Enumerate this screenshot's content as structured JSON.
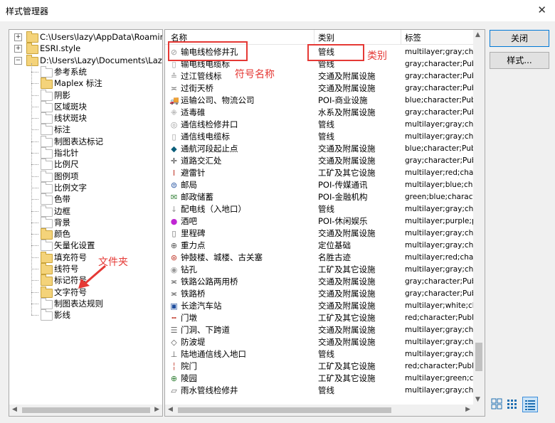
{
  "window": {
    "title": "样式管理器"
  },
  "tree": {
    "roots": [
      {
        "label": "C:\\Users\\lazy\\AppData\\Roaming\\E",
        "expanded": false
      },
      {
        "label": "ESRI.style",
        "expanded": false
      },
      {
        "label": "D:\\Users\\Lazy\\Documents\\Lazysh",
        "expanded": true
      }
    ],
    "children": [
      {
        "label": "参考系统",
        "filled": false
      },
      {
        "label": "Maplex 标注",
        "filled": true
      },
      {
        "label": "阴影",
        "filled": false
      },
      {
        "label": "区域斑块",
        "filled": false
      },
      {
        "label": "线状斑块",
        "filled": false
      },
      {
        "label": "标注",
        "filled": false
      },
      {
        "label": "制图表达标记",
        "filled": false
      },
      {
        "label": "指北针",
        "filled": false
      },
      {
        "label": "比例尺",
        "filled": false
      },
      {
        "label": "图例项",
        "filled": false
      },
      {
        "label": "比例文字",
        "filled": false
      },
      {
        "label": "色带",
        "filled": false
      },
      {
        "label": "边框",
        "filled": false
      },
      {
        "label": "背景",
        "filled": false
      },
      {
        "label": "颜色",
        "filled": true
      },
      {
        "label": "矢量化设置",
        "filled": false
      },
      {
        "label": "填充符号",
        "filled": true
      },
      {
        "label": "线符号",
        "filled": true
      },
      {
        "label": "标记符号",
        "filled": true
      },
      {
        "label": "文字符号",
        "filled": true
      },
      {
        "label": "制图表达规则",
        "filled": false
      },
      {
        "label": "影线",
        "filled": false
      }
    ]
  },
  "list": {
    "headers": {
      "name": "名称",
      "category": "类别",
      "tags": "标签"
    },
    "rows": [
      {
        "icon": "manhole-icon",
        "glyph": "⊘",
        "color": "#999999",
        "name": "输电线检修井孔",
        "category": "管线",
        "tags": "multilayer;gray;chara"
      },
      {
        "icon": "cable-marker-icon",
        "glyph": "▯",
        "color": "#999999",
        "name": "输电线电缆标",
        "category": "管线",
        "tags": "gray;character;Publ"
      },
      {
        "icon": "pipe-crossing-icon",
        "glyph": "≙",
        "color": "#999999",
        "name": "过江管线标",
        "category": "交通及附属设施",
        "tags": "gray;character;Publ"
      },
      {
        "icon": "overpass-icon",
        "glyph": "≍",
        "color": "#666666",
        "name": "过街天桥",
        "category": "交通及附属设施",
        "tags": "gray;character;Publ"
      },
      {
        "icon": "truck-icon",
        "glyph": "🚚",
        "color": "#1f4e9e",
        "name": "运输公司、物流公司",
        "category": "POI-商业设施",
        "tags": "blue;character;Publ"
      },
      {
        "icon": "dam-icon",
        "glyph": "⁜",
        "color": "#999999",
        "name": "适毒碓",
        "category": "水系及附属设施",
        "tags": "gray;character;Publ"
      },
      {
        "icon": "comm-manhole-icon",
        "glyph": "◎",
        "color": "#999999",
        "name": "通信线检修井口",
        "category": "管线",
        "tags": "multilayer;gray;chara"
      },
      {
        "icon": "comm-cable-icon",
        "glyph": "▯",
        "color": "#999999",
        "name": "通信线电缆标",
        "category": "管线",
        "tags": "multilayer;gray;chara"
      },
      {
        "icon": "diamond-icon",
        "glyph": "◆",
        "color": "#0b5e7a",
        "name": "通航河段起止点",
        "category": "交通及附属设施",
        "tags": "blue;character;Publ"
      },
      {
        "icon": "crossing-icon",
        "glyph": "✛",
        "color": "#333333",
        "name": "道路交汇处",
        "category": "交通及附属设施",
        "tags": "gray;character;Publ"
      },
      {
        "icon": "lightning-rod-icon",
        "glyph": "Ⅰ",
        "color": "#c0392b",
        "name": "避雷针",
        "category": "工矿及其它设施",
        "tags": "multilayer;red;chara"
      },
      {
        "icon": "post-office-icon",
        "glyph": "⊜",
        "color": "#1f4e9e",
        "name": "邮局",
        "category": "POI-传媒通讯",
        "tags": "multilayer;blue;chara"
      },
      {
        "icon": "postal-savings-icon",
        "glyph": "✉",
        "color": "#2e7d32",
        "name": "邮政储蓄",
        "category": "POI-金融机构",
        "tags": "green;blue;characte"
      },
      {
        "icon": "power-entry-icon",
        "glyph": "↓",
        "color": "#999999",
        "name": "配电线（入地口）",
        "category": "管线",
        "tags": "multilayer;gray;chara"
      },
      {
        "icon": "bar-icon",
        "glyph": "●",
        "color": "#c026d3",
        "name": "酒吧",
        "category": "POI-休闲娱乐",
        "tags": "multilayer;purple;pin"
      },
      {
        "icon": "milestone-icon",
        "glyph": "▯",
        "color": "#666666",
        "name": "里程碑",
        "category": "交通及附属设施",
        "tags": "multilayer;gray;chara"
      },
      {
        "icon": "gravity-point-icon",
        "glyph": "⊕",
        "color": "#555555",
        "name": "重力点",
        "category": "定位基础",
        "tags": "multilayer;gray;chara"
      },
      {
        "icon": "tower-icon",
        "glyph": "⊛",
        "color": "#c0392b",
        "name": "钟鼓楼、城楼、古关塞",
        "category": "名胜古迹",
        "tags": "multilayer;red;chara"
      },
      {
        "icon": "drill-hole-icon",
        "glyph": "◉",
        "color": "#999999",
        "name": "钻孔",
        "category": "工矿及其它设施",
        "tags": "multilayer;gray;chara"
      },
      {
        "icon": "rail-road-bridge-icon",
        "glyph": "≍",
        "color": "#333333",
        "name": "铁路公路两用桥",
        "category": "交通及附属设施",
        "tags": "gray;character;Publ"
      },
      {
        "icon": "railway-bridge-icon",
        "glyph": "≍",
        "color": "#333333",
        "name": "铁路桥",
        "category": "交通及附属设施",
        "tags": "gray;character;Publ"
      },
      {
        "icon": "bus-station-icon",
        "glyph": "▣",
        "color": "#1f4e9e",
        "name": "长途汽车站",
        "category": "交通及附属设施",
        "tags": "multilayer;white;cha"
      },
      {
        "icon": "gate-pier-icon",
        "glyph": "╍",
        "color": "#c0392b",
        "name": "门墩",
        "category": "工矿及其它设施",
        "tags": "red;character;Public"
      },
      {
        "icon": "gateway-icon",
        "glyph": "☰",
        "color": "#666666",
        "name": "门洞、下跨道",
        "category": "交通及附属设施",
        "tags": "multilayer;gray;chara"
      },
      {
        "icon": "breakwater-icon",
        "glyph": "◇",
        "color": "#555555",
        "name": "防波堤",
        "category": "交通及附属设施",
        "tags": "multilayer;gray;chara"
      },
      {
        "icon": "land-comm-entry-icon",
        "glyph": "⊥",
        "color": "#555555",
        "name": "陆地通信线入地口",
        "category": "管线",
        "tags": "multilayer;gray;chara"
      },
      {
        "icon": "courtyard-icon",
        "glyph": "╎",
        "color": "#c0392b",
        "name": "院门",
        "category": "工矿及其它设施",
        "tags": "red;character;Public"
      },
      {
        "icon": "cemetery-icon",
        "glyph": "⊕",
        "color": "#2e7d32",
        "name": "陵园",
        "category": "工矿及其它设施",
        "tags": "multilayer;green;cha"
      },
      {
        "icon": "rain-pipe-manhole-icon",
        "glyph": "▱",
        "color": "#666666",
        "name": "雨水管线检修井",
        "category": "管线",
        "tags": "multilayer;gray;chara"
      }
    ]
  },
  "buttons": {
    "close": "关闭",
    "styles": "样式..."
  },
  "annotations": {
    "symbol_name": "符号名称",
    "category": "类别",
    "folder": "文件夹"
  }
}
